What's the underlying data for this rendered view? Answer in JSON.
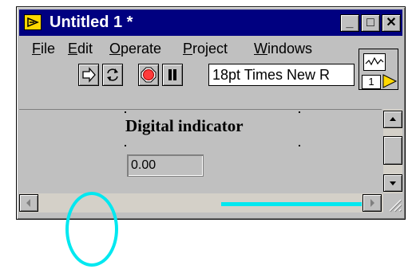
{
  "window": {
    "title": "Untitled 1 *",
    "title_buttons": [
      "_",
      "□",
      "✕"
    ],
    "vi_icon_number": "1"
  },
  "menu": {
    "items": [
      {
        "label": "File",
        "mnemonic": "F",
        "rest": "ile"
      },
      {
        "label": "Edit",
        "mnemonic": "E",
        "rest": "dit"
      },
      {
        "label": "Operate",
        "mnemonic": "O",
        "rest": "perate"
      },
      {
        "label": "Project",
        "mnemonic": "P",
        "rest": "roject"
      },
      {
        "label": "Windows",
        "mnemonic": "W",
        "rest": "indows"
      }
    ]
  },
  "toolbar": {
    "font_setting": "18pt Times New R"
  },
  "panel": {
    "indicator_label": "Digital indicator",
    "indicator_value": "0.00"
  },
  "colors": {
    "titlebar": "#000080",
    "face": "#c0c0c0",
    "annotation": "#00e8f0"
  }
}
